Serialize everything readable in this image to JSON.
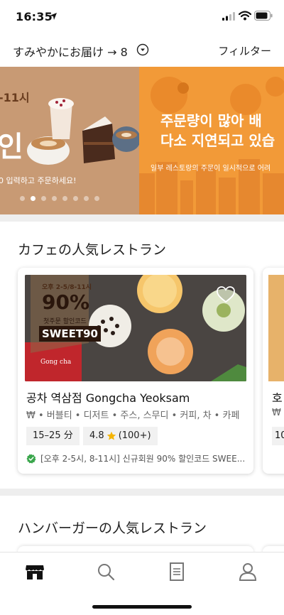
{
  "status_bar": {
    "time": "16:35"
  },
  "header": {
    "delivery_label": "すみやかにお届け → 8",
    "filter_label": "フィルター"
  },
  "banner": {
    "left_date": "-11시",
    "left_big": "인",
    "left_sub": "0 입력하고 주문하세요!",
    "right_title_line1": "주문량이 많아 배",
    "right_title_line2": "다소 지연되고 있습",
    "right_sub": "일부 레스토랑의 주문이 일시적으로 어려",
    "dot_count": 8,
    "active_dot": 1
  },
  "sections": {
    "cafe_title": "カフェの人気レストラン",
    "burger_title": "ハンバーガーの人気レストラン"
  },
  "card": {
    "image_badge_time": "오후 2-5/8-11시",
    "image_badge_percent": "90%",
    "image_badge_caption": "첫주문 할인코드",
    "image_badge_code": "SWEET90",
    "image_brand": "Gong cha",
    "name": "공차 역삼점 Gongcha Yeoksam",
    "categories": "₩ • 버블티 • 디저트 • 주스, 스무디 • 커피, 차 • 카페",
    "delivery_time": "15–25 分",
    "rating": "4.8",
    "rating_count": "(100+)",
    "promo": "[오후 2-5시, 8-11시] 신규회원 90% 할인코드 SWEE..."
  },
  "peek_card": {
    "name": "호",
    "category": "₩",
    "chip": "10"
  },
  "colors": {
    "promo_green": "#3aa64c",
    "star": "#f5b400",
    "banner_orange": "#f29a38",
    "banner_brown": "#c89a74"
  },
  "tabs": [
    "home-icon",
    "search-icon",
    "orders-icon",
    "account-icon"
  ]
}
